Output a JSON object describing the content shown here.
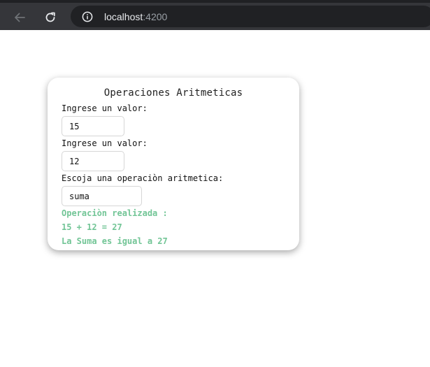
{
  "browser": {
    "url_host": "localhost",
    "url_port": ":4200",
    "icons": [
      "back-arrow-icon",
      "reload-icon",
      "info-icon"
    ]
  },
  "card": {
    "title": "Operaciones Aritmeticas",
    "value1_label": "Ingrese un valor:",
    "value1": "15",
    "value2_label": "Ingrese un valor:",
    "value2": "12",
    "operation_label": "Escoja una operaciòn aritmetica:",
    "operation": "suma",
    "result_heading": "Operaciòn realizada :",
    "result_expression": "15 + 12 = 27",
    "result_sentence": "La Suma es igual a 27"
  },
  "colors": {
    "result_text": "#72c596",
    "chrome_bar": "#35363a",
    "omnibox": "#202124"
  }
}
